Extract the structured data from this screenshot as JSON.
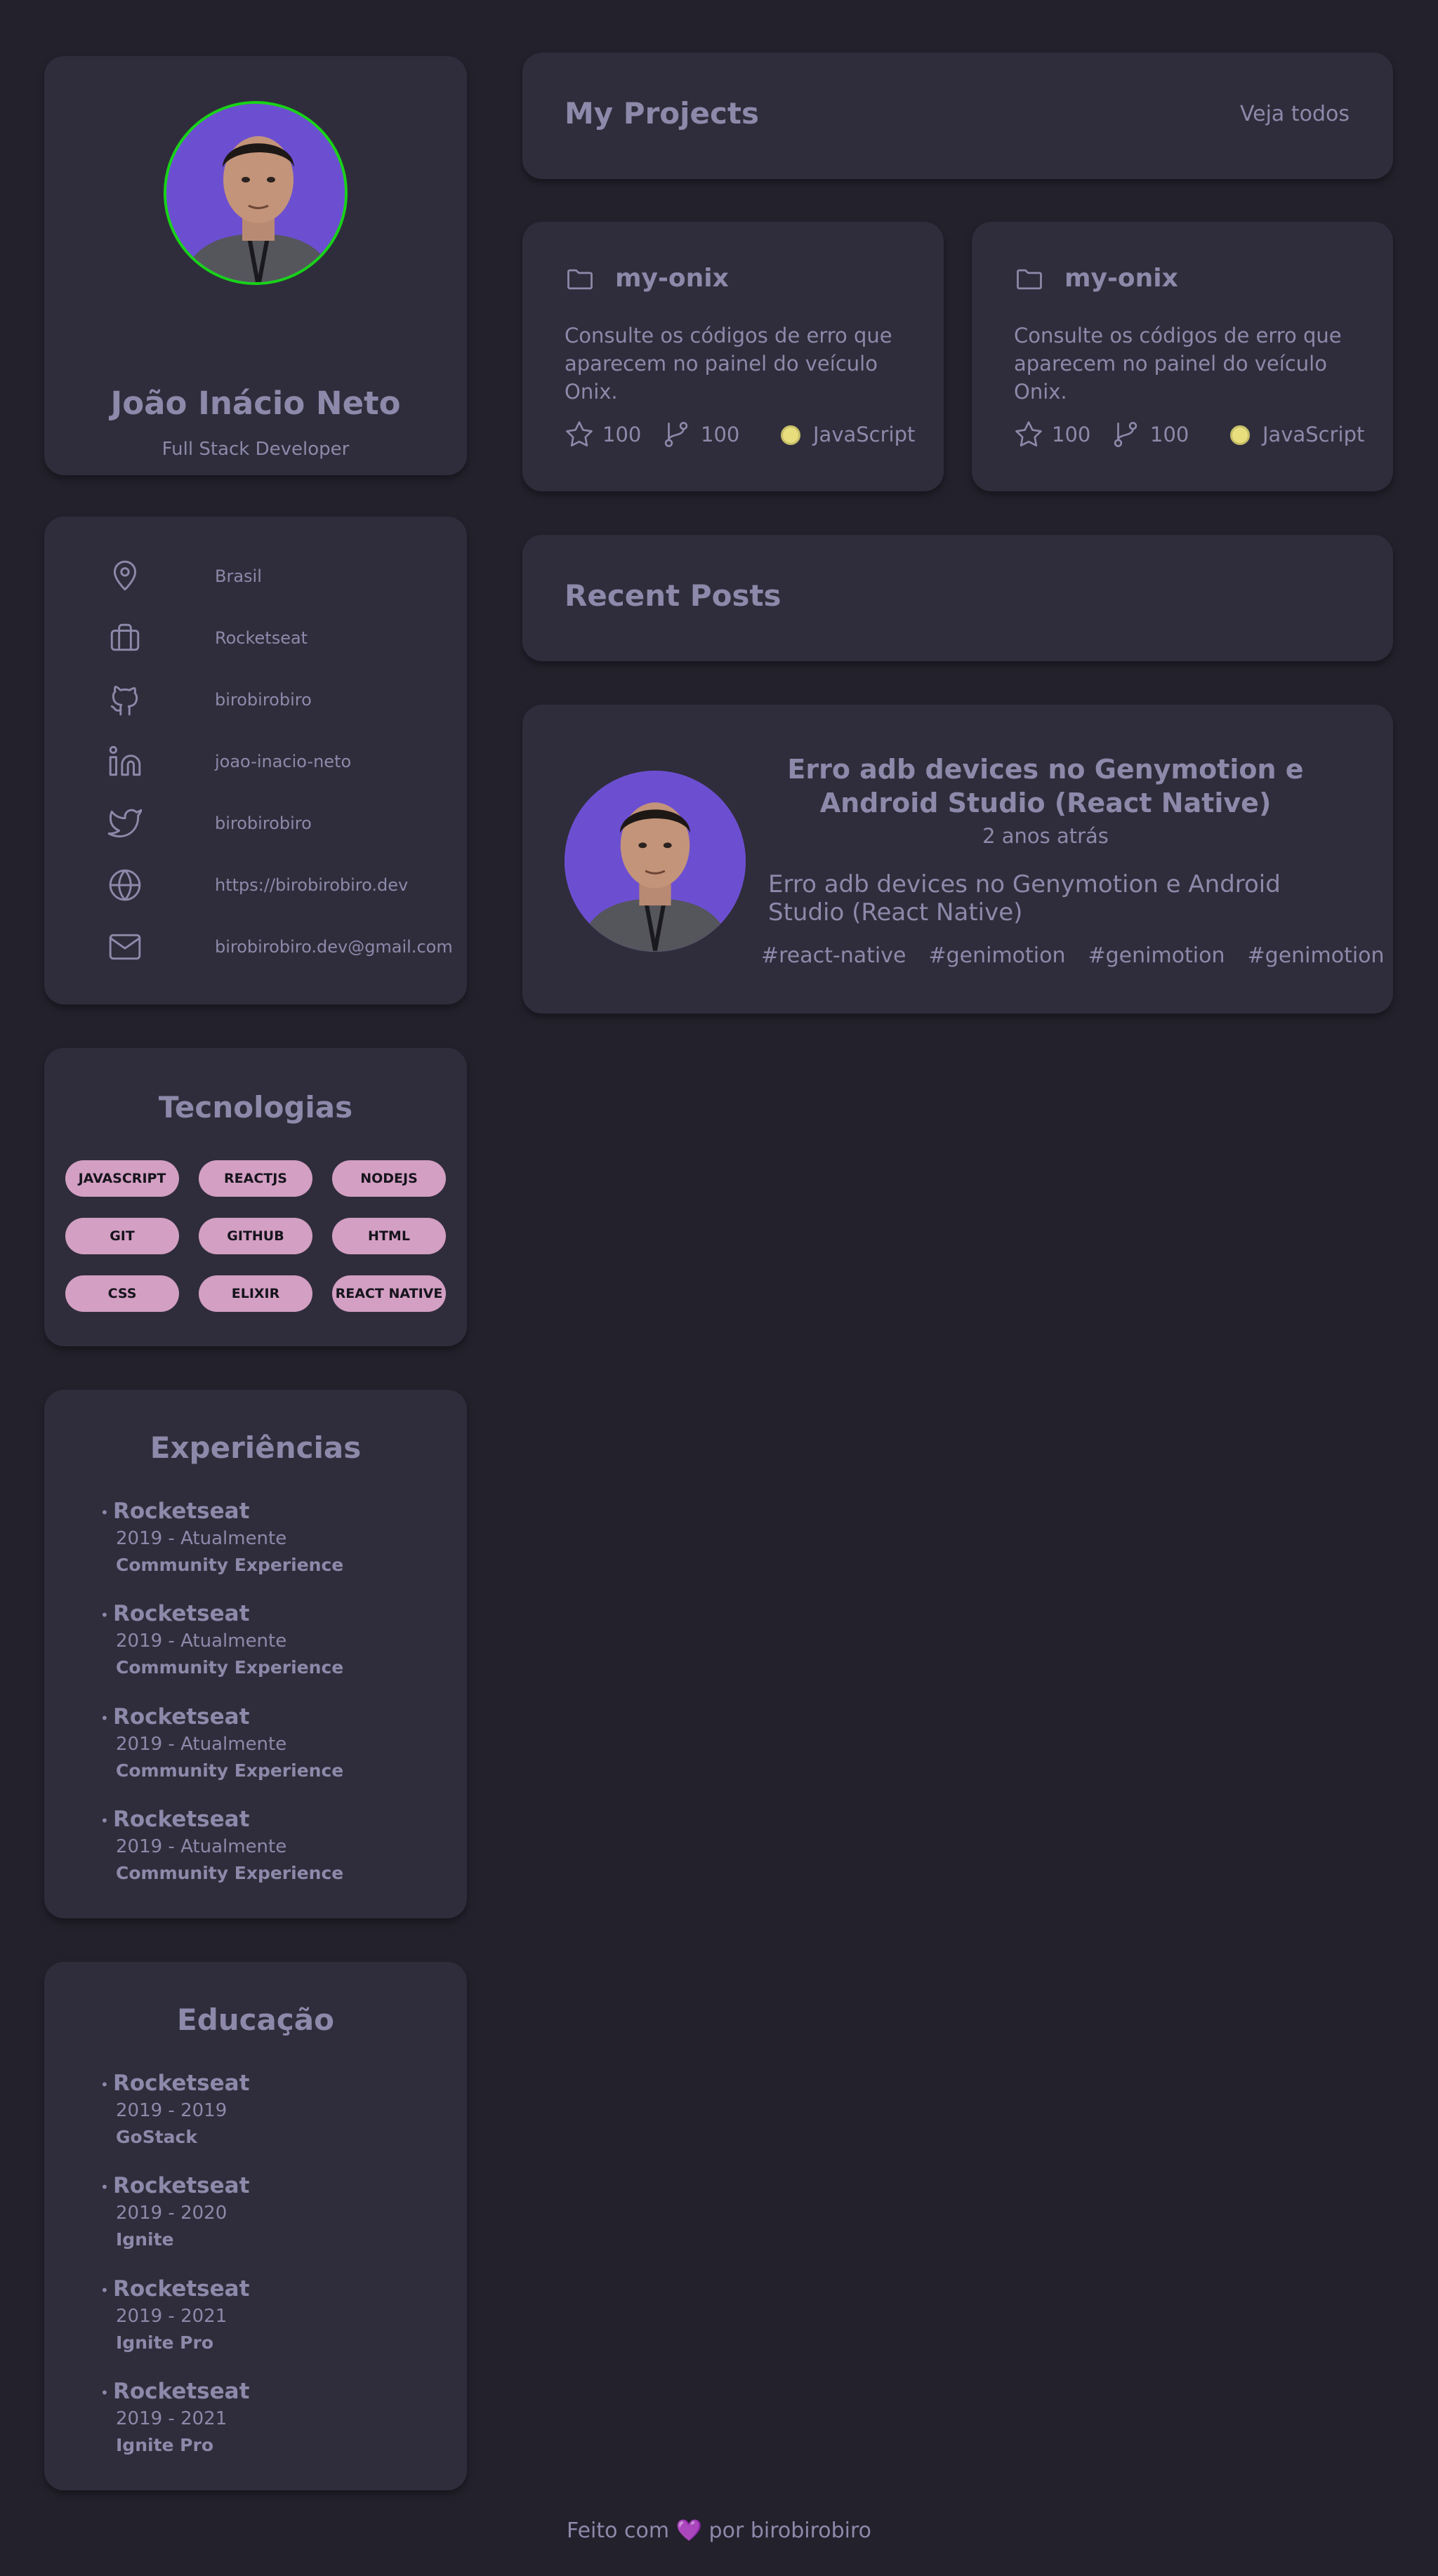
{
  "profile": {
    "name": "João Inácio Neto",
    "role": "Full Stack Developer"
  },
  "contacts": [
    {
      "icon": "location-icon",
      "text": "Brasil"
    },
    {
      "icon": "briefcase-icon",
      "text": "Rocketseat"
    },
    {
      "icon": "github-icon",
      "text": "birobirobiro"
    },
    {
      "icon": "linkedin-icon",
      "text": "joao-inacio-neto"
    },
    {
      "icon": "twitter-icon",
      "text": "birobirobiro"
    },
    {
      "icon": "globe-icon",
      "text": "https://birobirobiro.dev"
    },
    {
      "icon": "mail-icon",
      "text": "birobirobiro.dev@gmail.com"
    }
  ],
  "technologies": {
    "title": "Tecnologias",
    "tags": [
      "JAVASCRIPT",
      "REACTJS",
      "NODEJS",
      "GIT",
      "GITHUB",
      "HTML",
      "CSS",
      "ELIXIR",
      "REACT NATIVE"
    ]
  },
  "experiences": {
    "title": "Experiências",
    "items": [
      {
        "org": "Rocketseat",
        "period": "2019 - Atualmente",
        "role": "Community Experience"
      },
      {
        "org": "Rocketseat",
        "period": "2019 - Atualmente",
        "role": "Community Experience"
      },
      {
        "org": "Rocketseat",
        "period": "2019 - Atualmente",
        "role": "Community Experience"
      },
      {
        "org": "Rocketseat",
        "period": "2019 - Atualmente",
        "role": "Community Experience"
      }
    ]
  },
  "education": {
    "title": "Educação",
    "items": [
      {
        "org": "Rocketseat",
        "period": "2019 - 2019",
        "course": "GoStack"
      },
      {
        "org": "Rocketseat",
        "period": "2019 - 2020",
        "course": "Ignite"
      },
      {
        "org": "Rocketseat",
        "period": "2019 - 2021",
        "course": "Ignite Pro"
      },
      {
        "org": "Rocketseat",
        "period": "2019 - 2021",
        "course": "Ignite Pro"
      }
    ]
  },
  "projects": {
    "title": "My Projects",
    "see_all": "Veja todos",
    "items": [
      {
        "name": "my-onix",
        "description": "Consulte os códigos de erro que aparecem no painel do veículo Onix.",
        "stars": "100",
        "forks": "100",
        "language": "JavaScript"
      },
      {
        "name": "my-onix",
        "description": "Consulte os códigos de erro que aparecem no painel do veículo Onix.",
        "stars": "100",
        "forks": "100",
        "language": "JavaScript"
      }
    ]
  },
  "posts": {
    "title": "Recent Posts",
    "items": [
      {
        "title": "Erro adb devices no Genymotion e Android Studio (React Native)",
        "time": "2 anos atrás",
        "body": "Erro adb devices no Genymotion e Android Studio (React Native)",
        "tags": [
          "#react-native",
          "#genimotion",
          "#genimotion",
          "#genimotion"
        ]
      }
    ]
  },
  "footer": {
    "before": "Feito com",
    "heart": "💜",
    "after": "por birobirobiro"
  },
  "colors": {
    "background": "#23212c",
    "card": "#2f2d3b",
    "text": "#8d89aa",
    "tag": "#d39fc3",
    "avatar_ring": "#18d318",
    "avatar_bg": "#6c4fd1",
    "language_dot": "#e8de7e"
  }
}
